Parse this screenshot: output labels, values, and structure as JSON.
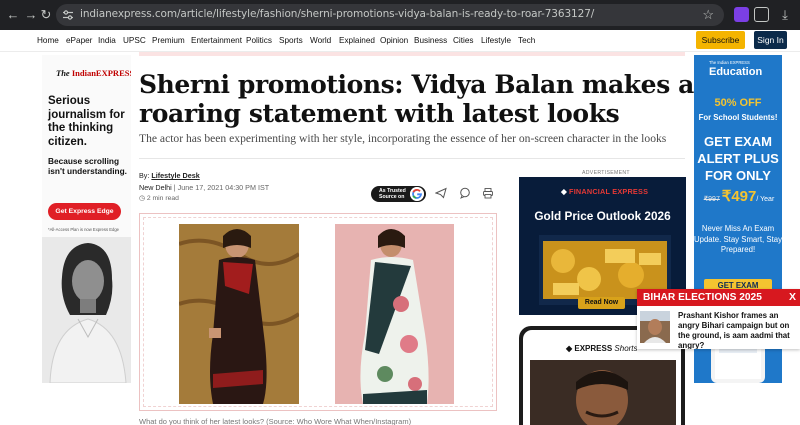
{
  "browser": {
    "url": "indianexpress.com/article/lifestyle/fashion/sherni-promotions-vidya-balan-is-ready-to-roar-7363127/",
    "icons": [
      "back-icon",
      "forward-icon",
      "reload-icon",
      "site-settings-icon",
      "bookmark-star-icon",
      "extension-icon",
      "download-icon"
    ]
  },
  "nav": {
    "items": [
      "Home",
      "ePaper",
      "India",
      "UPSC",
      "Premium",
      "Entertainment",
      "Politics",
      "Sports",
      "World",
      "Explained",
      "Opinion",
      "Business",
      "Cities",
      "Lifestyle",
      "Tech"
    ],
    "subscribe": "Subscribe",
    "signin": "Sign In"
  },
  "left_ad": {
    "logo_prefix": "The",
    "logo_name": "IndianEXPRESS",
    "headline": "Serious journalism for the thinking citizen.",
    "subhead": "Because scrolling isn't understanding.",
    "cta": "Get Express Edge",
    "fine_print": "*All-Access Plan is now Express Edge"
  },
  "article": {
    "title": "Sherni promotions: Vidya Balan makes a roaring statement with latest looks",
    "deck": "The actor has been experimenting with her style, incorporating the essence of her on-screen character in the looks",
    "by_label": "By:",
    "author": "Lifestyle Desk",
    "place": "New Delhi",
    "date": "June 17, 2021 04:30 PM IST",
    "read_time": "2 min read",
    "trusted_line1": "As Trusted",
    "trusted_line2": "Source on",
    "caption": "What do you think of her latest looks? (Source: Who Wore What When/Instagram)"
  },
  "right_column": {
    "advertisement": "ADVERTISEMENT",
    "fe_logo": "FINANCIAL EXPRESS",
    "fe_headline": "Gold Price Outlook 2026",
    "fe_button": "Read Now",
    "shorts_logo_bold": "EXPRESS",
    "shorts_logo_italic": "Shorts"
  },
  "right_ad": {
    "logo_small": "The Indian EXPRESS",
    "logo_big": "Education",
    "offer": "50% OFF",
    "offer_for": "For School Students!",
    "headline": "GET EXAM ALERT PLUS FOR ONLY",
    "old_price": "₹997",
    "new_price": "₹497",
    "per": "/ Year",
    "sub": "Never Miss An Exam Update. Stay Smart, Stay Prepared!",
    "button": "GET EXAM"
  },
  "popup": {
    "title": "BIHAR ELECTIONS 2025",
    "close": "X",
    "text": "Prashant Kishor frames an angry Bihari campaign but on the ground, is aam aadmi that angry?"
  }
}
